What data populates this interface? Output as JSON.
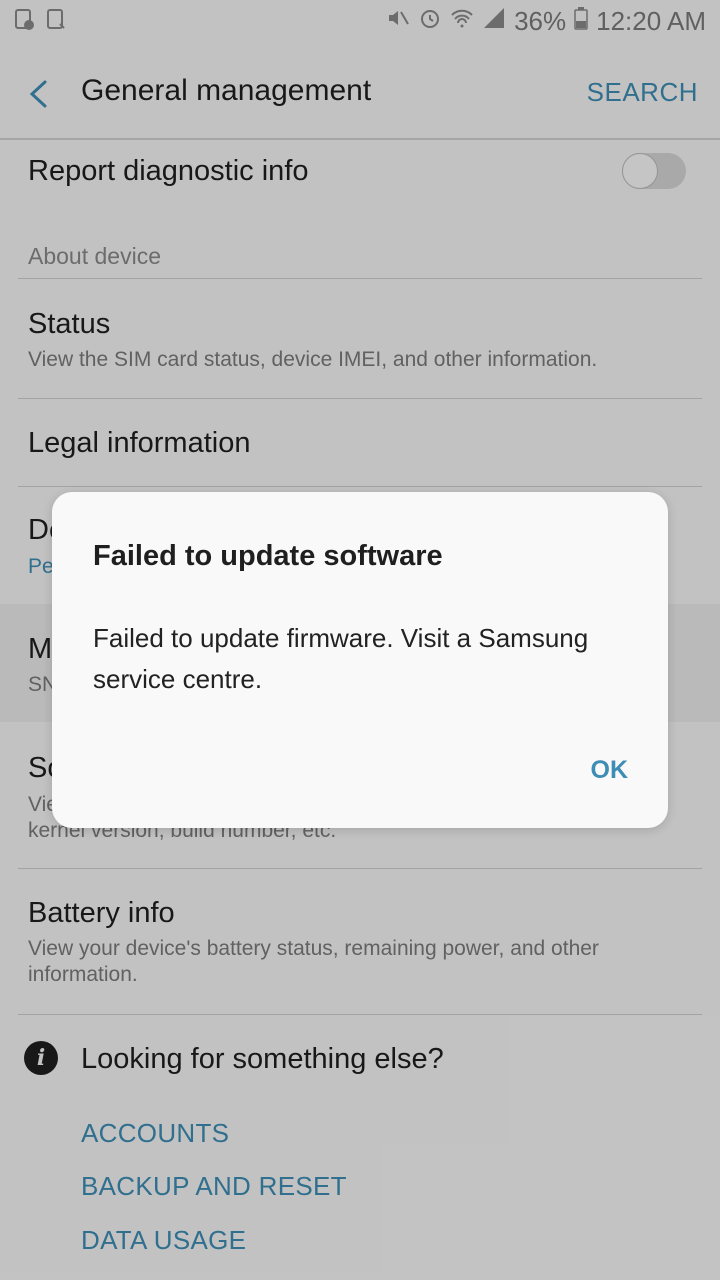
{
  "status_bar": {
    "battery": "36%",
    "time": "12:20 AM"
  },
  "app_bar": {
    "title": "General management",
    "search": "SEARCH"
  },
  "items": {
    "report_diagnostic": "Report diagnostic info",
    "about_device_header": "About device",
    "status_title": "Status",
    "status_sub": "View the SIM card status, device IMEI, and other information.",
    "legal_title": "Legal information",
    "device_partial_title": "De",
    "device_partial_sub": "Pe",
    "m_partial_title": "M",
    "m_partial_sub": "SN",
    "software_partial_title": "So",
    "software_partial_sub_line1": "Vie",
    "software_partial_sub_line2": "kernel version, build number, etc.",
    "battery_title": "Battery info",
    "battery_sub": "View your device's battery status, remaining power, and other information."
  },
  "looking": {
    "title": "Looking for something else?",
    "links": [
      "ACCOUNTS",
      "BACKUP AND RESET",
      "DATA USAGE"
    ]
  },
  "dialog": {
    "title": "Failed to update software",
    "message": "Failed to update firmware. Visit a Samsung service centre.",
    "ok": "OK"
  }
}
